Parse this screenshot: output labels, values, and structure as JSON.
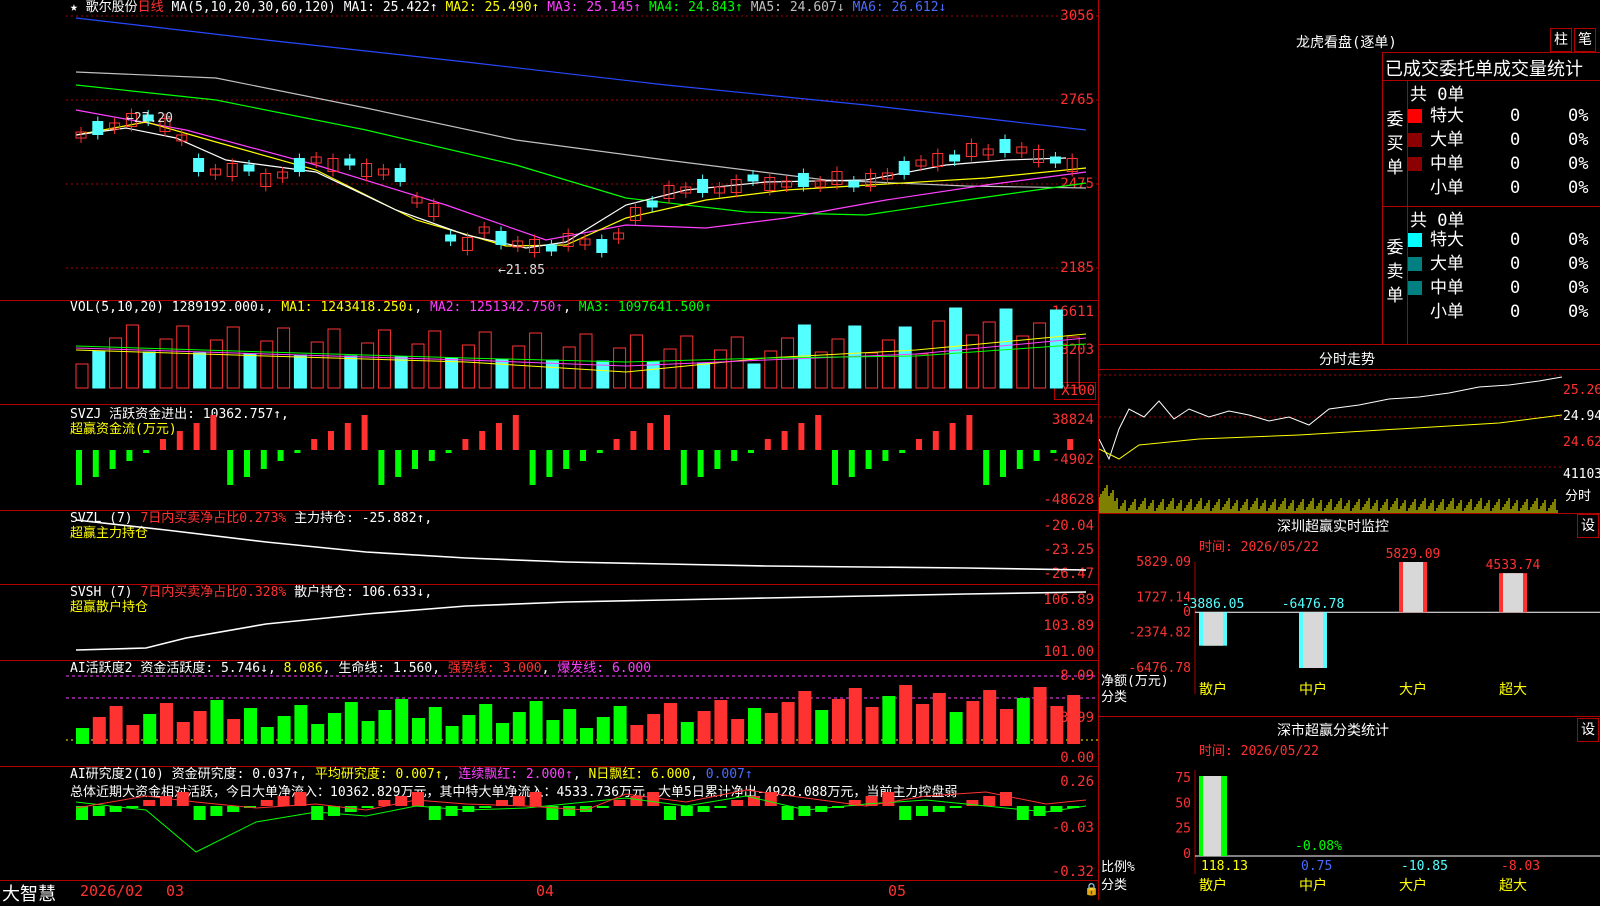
{
  "main": {
    "header": {
      "stock": "★ 歌尔股份",
      "period": "日线",
      "ma_label": "MA(5,10,20,30,60,120)",
      "ma1": "MA1: 25.422↑",
      "ma2": "MA2: 25.490↑",
      "ma3": "MA3: 25.145↑",
      "ma4": "MA4: 24.843↑",
      "ma5": "MA5: 24.607↓",
      "ma6": "MA6: 26.612↓"
    },
    "y_ticks": [
      "3056",
      "2765",
      "2475",
      "2185"
    ],
    "high_label": "←27.20",
    "low_label": "←21.85"
  },
  "vol": {
    "header": "VOL(5,10,20) 1289192.000↓",
    "ma1": "MA1: 1243418.250↓",
    "ma2": "MA2: 1251342.750↑",
    "ma3": "MA3: 1097641.500↑",
    "y_ticks": [
      "16611",
      "8203"
    ],
    "unit": "X100"
  },
  "svzj": {
    "header": "SVZJ  活跃资金进出: 10362.757↑,",
    "sub": "超赢资金流(万元)",
    "y_ticks": [
      "38824",
      "-4902",
      "-48628"
    ]
  },
  "svzl": {
    "name": "SVZL (7)",
    "ratio": "7日内买卖净占比0.273%",
    "hold": "主力持仓: -25.882↑,",
    "sub": "超赢主力持仓",
    "y_ticks": [
      "-20.04",
      "-23.25",
      "-26.47"
    ]
  },
  "svsh": {
    "name": "SVSH (7)",
    "ratio": "7日内买卖净占比0.328%",
    "hold": "散户持仓: 106.633↓,",
    "sub": "超赢散户持仓",
    "y_ticks": [
      "106.89",
      "103.89",
      "101.00"
    ]
  },
  "ai1": {
    "name": "AI活跃度2",
    "a": "资金活跃度: 5.746↓",
    "b": "8.086",
    "c": "生命线: 1.560",
    "d": "强势线: 3.000",
    "e": "爆发线: 6.000",
    "y_ticks": [
      "8.09",
      "3.99",
      "0.00"
    ]
  },
  "ai2": {
    "name": "AI研究度2(10)",
    "a": "资金研究度: 0.037↑",
    "b": "平均研究度: 0.007↑",
    "c": "连续飘红: 2.000↑",
    "d": "N日飘红: 6.000",
    "e": "0.007↑",
    "summary": "总体近期大资金相对活跃，今日大单净流入：10362.829万元，其中特大单净流入：4533.736万元，大单5日累计净出-4928.088万元，当前主力控盘弱",
    "y_ticks": [
      "0.26",
      "-0.03",
      "-0.32"
    ]
  },
  "xaxis": {
    "brand": "大智慧",
    "labels": [
      "2026/02",
      "03",
      "04",
      "05"
    ]
  },
  "right": {
    "lhb_title": "龙虎看盘(逐单)",
    "btn_a": "柱",
    "btn_b": "笔",
    "table_title": "已成交委托单成交量统计",
    "buy": {
      "total": "共 0单",
      "side": "委买单",
      "rows": [
        {
          "label": "特大",
          "v": "0",
          "p": "0%"
        },
        {
          "label": "大单",
          "v": "0",
          "p": "0%"
        },
        {
          "label": "中单",
          "v": "0",
          "p": "0%"
        },
        {
          "label": "小单",
          "v": "0",
          "p": "0%"
        }
      ]
    },
    "sell": {
      "total": "共 0单",
      "side": "委卖单",
      "rows": [
        {
          "label": "特大",
          "v": "0",
          "p": "0%"
        },
        {
          "label": "大单",
          "v": "0",
          "p": "0%"
        },
        {
          "label": "中单",
          "v": "0",
          "p": "0%"
        },
        {
          "label": "小单",
          "v": "0",
          "p": "0%"
        }
      ]
    },
    "fs_title": "分时走势",
    "fs_ticks": [
      "25.26",
      "24.94",
      "24.62"
    ],
    "fs_vol": "41103",
    "fs_vol_unit": "分时",
    "rt_title": "深圳超赢实时监控",
    "rt_time": "时间: 2026/05/22",
    "rt_set": "设",
    "rt_ticks": [
      "5829.09",
      "1727.14",
      "0",
      "-2374.82",
      "-6476.78"
    ],
    "rt_unit1": "净额(万元)",
    "rt_unit2": "分类",
    "rt_bars": [
      {
        "label": "散户",
        "value": -3886.05,
        "text": "-3886.05"
      },
      {
        "label": "中户",
        "value": -6476.78,
        "text": "-6476.78"
      },
      {
        "label": "大户",
        "value": 5829.09,
        "text": "5829.09"
      },
      {
        "label": "超大",
        "value": 4533.74,
        "text": "4533.74"
      }
    ],
    "cls_title": "深市超赢分类统计",
    "cls_time": "时间: 2026/05/22",
    "cls_set": "设",
    "cls_ticks": [
      "75",
      "50",
      "25",
      "0"
    ],
    "cls_unit1": "比例%",
    "cls_unit2": "分类",
    "cls_bars": [
      {
        "label": "散户",
        "value": 118.13,
        "text": "118.13"
      },
      {
        "label": "中户",
        "value": -0.08,
        "text": "-0.08%"
      },
      {
        "label": "大户",
        "value": -10.85,
        "text": "-10.85"
      },
      {
        "label": "超大",
        "value": -8.03,
        "text": "-8.03"
      }
    ],
    "cls_mid_text": "0.75"
  },
  "colors": {
    "up": "#ff3232",
    "down": "#54ffff",
    "grid": "#b00000",
    "ma1": "#ffffff",
    "ma2": "#ffff00",
    "ma3": "#ff40ff",
    "ma4": "#00ff00",
    "ma5": "#c0c0c0",
    "ma6": "#2848ff"
  }
}
